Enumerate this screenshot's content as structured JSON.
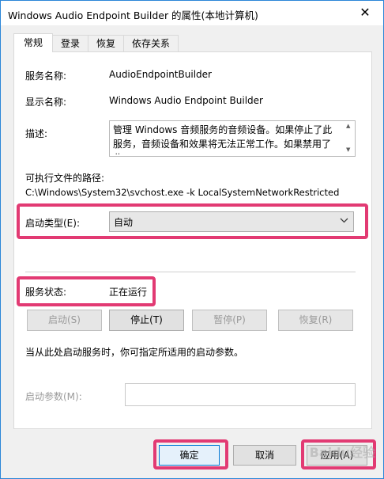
{
  "window": {
    "title": "Windows Audio Endpoint Builder 的属性(本地计算机)",
    "close_glyph": "✕"
  },
  "tabs": [
    {
      "label": "常规",
      "active": true
    },
    {
      "label": "登录",
      "active": false
    },
    {
      "label": "恢复",
      "active": false
    },
    {
      "label": "依存关系",
      "active": false
    }
  ],
  "general": {
    "service_name_label": "服务名称:",
    "service_name_value": "AudioEndpointBuilder",
    "display_name_label": "显示名称:",
    "display_name_value": "Windows Audio Endpoint Builder",
    "description_label": "描述:",
    "description_value": "管理 Windows 音频服务的音频设备。如果停止了此服务，音频设备和效果将无法正常工作。如果禁用了此",
    "path_label": "可执行文件的路径:",
    "path_value": "C:\\Windows\\System32\\svchost.exe -k LocalSystemNetworkRestricted",
    "startup_type_label": "启动类型(E):",
    "startup_type_value": "自动",
    "status_label": "服务状态:",
    "status_value": "正在运行",
    "buttons": {
      "start": "启动(S)",
      "stop": "停止(T)",
      "pause": "暂停(P)",
      "resume": "恢复(R)"
    },
    "hint": "当从此处启动服务时，你可指定所适用的启动参数。",
    "params_label": "启动参数(M):",
    "params_value": ""
  },
  "footer": {
    "ok": "确定",
    "cancel": "取消",
    "apply": "应用(A)"
  },
  "watermark": "Baidu经验",
  "colors": {
    "highlight": "#e23a73",
    "window_border": "#2b86d8",
    "default_button": "#0078d7"
  }
}
